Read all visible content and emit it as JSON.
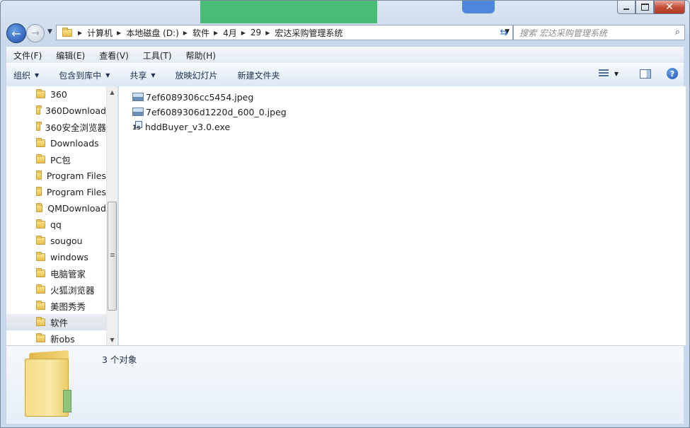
{
  "window": {
    "caption_buttons": [
      "minimize",
      "maximize",
      "close"
    ]
  },
  "navigation": {
    "breadcrumb": [
      "计算机",
      "本地磁盘 (D:)",
      "软件",
      "4月",
      "29",
      "宏达采购管理系统"
    ],
    "search_placeholder": "搜索 宏达采购管理系统"
  },
  "menu": [
    "文件(F)",
    "编辑(E)",
    "查看(V)",
    "工具(T)",
    "帮助(H)"
  ],
  "commands": {
    "organize": "组织",
    "include_in_library": "包含到库中",
    "share": "共享",
    "slideshow": "放映幻灯片",
    "new_folder": "新建文件夹"
  },
  "sidebar": {
    "items": [
      {
        "label": "360"
      },
      {
        "label": "360Download"
      },
      {
        "label": "360安全浏览器"
      },
      {
        "label": "Downloads"
      },
      {
        "label": "PC包"
      },
      {
        "label": "Program Files"
      },
      {
        "label": "Program Files"
      },
      {
        "label": "QMDownload"
      },
      {
        "label": "qq"
      },
      {
        "label": "sougou"
      },
      {
        "label": "windows"
      },
      {
        "label": "电脑管家"
      },
      {
        "label": "火狐浏览器"
      },
      {
        "label": "美图秀秀"
      },
      {
        "label": "软件",
        "selected": true
      },
      {
        "label": "新obs"
      }
    ]
  },
  "files": [
    {
      "name": "7ef6089306cc5454.jpeg",
      "icon": "image-file-icon"
    },
    {
      "name": "7ef6089306d1220d_600_0.jpeg",
      "icon": "image-file-icon"
    },
    {
      "name": "hddBuyer_v3.0.exe",
      "icon": "exe-file-icon"
    }
  ],
  "details": {
    "item_count": "3 个对象"
  }
}
